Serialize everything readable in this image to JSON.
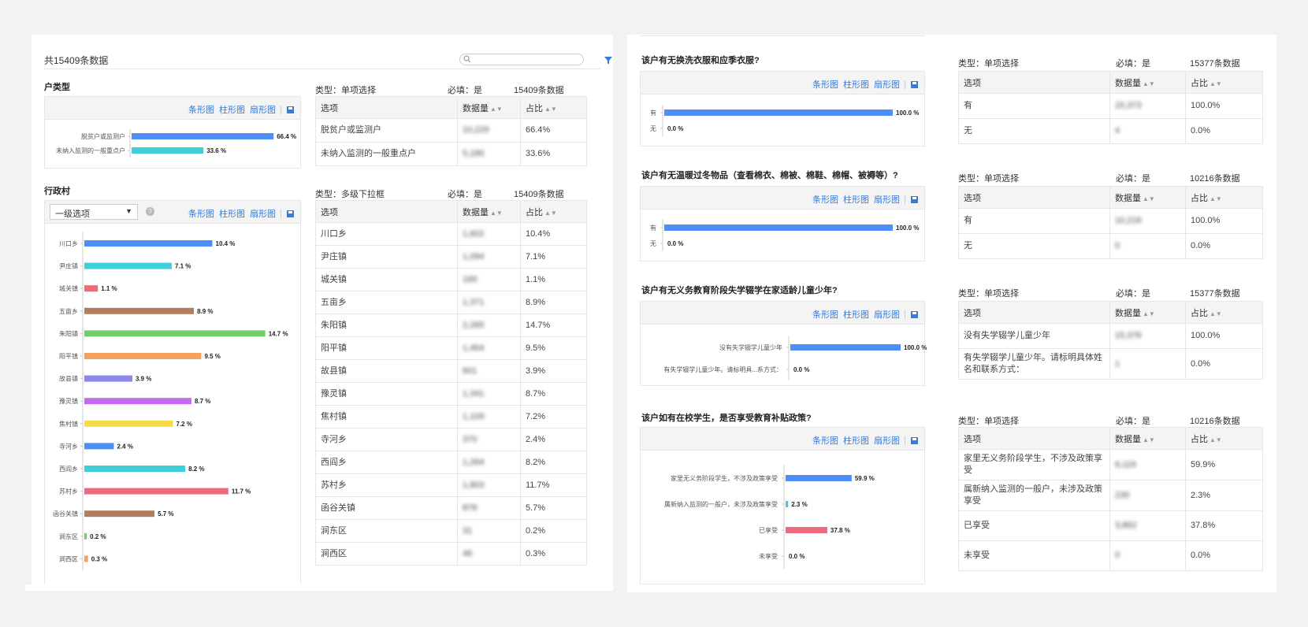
{
  "header": {
    "count_text": "共15409条数据",
    "search_placeholder": ""
  },
  "toolbar_links": {
    "bar_h": "条形图",
    "bar_v": "柱形图",
    "pie": "扇形图"
  },
  "colors": {
    "link": "#3a7bd5",
    "palette": [
      "#4e8ef7",
      "#3ecfd8",
      "#ef6a7a",
      "#b07e5c",
      "#6fd06a",
      "#f7a05c",
      "#8a88e8",
      "#c46af0",
      "#f7dc4a"
    ]
  },
  "col_headers": {
    "option": "选项",
    "count": "数据量",
    "ratio": "占比"
  },
  "left": {
    "sections": [
      {
        "title": "户类型",
        "meta": {
          "type": "类型：单项选择",
          "required": "必填：是",
          "count": "15409条数据"
        },
        "rows": [
          {
            "option": "脱贫户或监测户",
            "count": "10,229",
            "ratio": "66.4%"
          },
          {
            "option": "未纳入监测的一般重点户",
            "count": "5,180",
            "ratio": "33.6%"
          }
        ]
      },
      {
        "title": "行政村",
        "select_value": "一级选项",
        "meta": {
          "type": "类型：多级下拉框",
          "required": "必填：是",
          "count": "15409条数据"
        },
        "rows": [
          {
            "option": "川口乡",
            "count": "1,602",
            "ratio": "10.4%"
          },
          {
            "option": "尹庄镇",
            "count": "1,094",
            "ratio": "7.1%"
          },
          {
            "option": "城关镇",
            "count": "169",
            "ratio": "1.1%"
          },
          {
            "option": "五亩乡",
            "count": "1,371",
            "ratio": "8.9%"
          },
          {
            "option": "朱阳镇",
            "count": "2,265",
            "ratio": "14.7%"
          },
          {
            "option": "阳平镇",
            "count": "1,464",
            "ratio": "9.5%"
          },
          {
            "option": "故县镇",
            "count": "601",
            "ratio": "3.9%"
          },
          {
            "option": "豫灵镇",
            "count": "1,341",
            "ratio": "8.7%"
          },
          {
            "option": "焦村镇",
            "count": "1,109",
            "ratio": "7.2%"
          },
          {
            "option": "寺河乡",
            "count": "370",
            "ratio": "2.4%"
          },
          {
            "option": "西阎乡",
            "count": "1,264",
            "ratio": "8.2%"
          },
          {
            "option": "苏村乡",
            "count": "1,803",
            "ratio": "11.7%"
          },
          {
            "option": "函谷关镇",
            "count": "878",
            "ratio": "5.7%"
          },
          {
            "option": "涧东区",
            "count": "31",
            "ratio": "0.2%"
          },
          {
            "option": "涧西区",
            "count": "46",
            "ratio": "0.3%"
          }
        ]
      }
    ]
  },
  "right": {
    "sections": [
      {
        "title": "该户有无换洗衣服和应季衣服?",
        "meta": {
          "type": "类型：单项选择",
          "required": "必填：是",
          "count": "15377条数据"
        },
        "rows": [
          {
            "option": "有",
            "count": "15,373",
            "ratio": "100.0%"
          },
          {
            "option": "无",
            "count": "4",
            "ratio": "0.0%"
          }
        ]
      },
      {
        "title": "该户有无温暖过冬物品（查看棉衣、棉被、棉鞋、棉帽、被褥等）?",
        "meta": {
          "type": "类型：单项选择",
          "required": "必填：是",
          "count": "10216条数据"
        },
        "rows": [
          {
            "option": "有",
            "count": "10,216",
            "ratio": "100.0%"
          },
          {
            "option": "无",
            "count": "0",
            "ratio": "0.0%"
          }
        ]
      },
      {
        "title": "该户有无义务教育阶段失学辍学在家适龄儿童少年?",
        "meta": {
          "type": "类型：单项选择",
          "required": "必填：是",
          "count": "15377条数据"
        },
        "rows": [
          {
            "option": "没有失学辍学儿童少年",
            "count": "15,376",
            "ratio": "100.0%"
          },
          {
            "option": "有失学辍学儿童少年。请标明具体姓名和联系方式：",
            "count": "1",
            "ratio": "0.0%"
          }
        ],
        "chart_label_short": "有失学辍学儿童少年。请标明具...系方式："
      },
      {
        "title": "该户如有在校学生，是否享受教育补贴政策?",
        "meta": {
          "type": "类型：单项选择",
          "required": "必填：是",
          "count": "10216条数据"
        },
        "rows": [
          {
            "option": "家里无义务阶段学生，不涉及政策享受",
            "count": "6,119",
            "ratio": "59.9%"
          },
          {
            "option": "属新纳入监测的一般户，未涉及政策享受",
            "count": "235",
            "ratio": "2.3%"
          },
          {
            "option": "已享受",
            "count": "3,862",
            "ratio": "37.8%"
          },
          {
            "option": "未享受",
            "count": "0",
            "ratio": "0.0%"
          }
        ],
        "chart_labels_short": [
          "家里无义务阶段学生，不涉及政策享受",
          "属新纳入监测的一般户，未涉及政策享受",
          "已享受",
          "未享受"
        ]
      }
    ]
  },
  "chart_data": [
    {
      "type": "bar",
      "orientation": "horizontal",
      "categories": [
        "脱贫户或监测户",
        "未纳入监测的一般重点户"
      ],
      "values": [
        66.4,
        33.6
      ],
      "value_labels": [
        "66.4 %",
        "33.6 %"
      ]
    },
    {
      "type": "bar",
      "orientation": "horizontal",
      "categories": [
        "川口乡",
        "尹庄镇",
        "城关镇",
        "五亩乡",
        "朱阳镇",
        "阳平镇",
        "故县镇",
        "豫灵镇",
        "焦村镇",
        "寺河乡",
        "西阎乡",
        "苏村乡",
        "函谷关镇",
        "涧东区",
        "涧西区"
      ],
      "values": [
        10.4,
        7.1,
        1.1,
        8.9,
        14.7,
        9.5,
        3.9,
        8.7,
        7.2,
        2.4,
        8.2,
        11.7,
        5.7,
        0.2,
        0.3
      ],
      "value_labels": [
        "10.4 %",
        "7.1 %",
        "1.1 %",
        "8.9 %",
        "14.7 %",
        "9.5 %",
        "3.9 %",
        "8.7 %",
        "7.2 %",
        "2.4 %",
        "8.2 %",
        "11.7 %",
        "5.7 %",
        "0.2 %",
        "0.3 %"
      ]
    },
    {
      "type": "bar",
      "orientation": "horizontal",
      "categories": [
        "有",
        "无"
      ],
      "values": [
        100.0,
        0.0
      ],
      "value_labels": [
        "100.0 %",
        "0.0 %"
      ]
    },
    {
      "type": "bar",
      "orientation": "horizontal",
      "categories": [
        "有",
        "无"
      ],
      "values": [
        100.0,
        0.0
      ],
      "value_labels": [
        "100.0 %",
        "0.0 %"
      ]
    },
    {
      "type": "bar",
      "orientation": "horizontal",
      "categories": [
        "没有失学辍学儿童少年",
        "有失学辍学儿童少年。请标明具...系方式："
      ],
      "values": [
        100.0,
        0.0
      ],
      "value_labels": [
        "100.0 %",
        "0.0 %"
      ]
    },
    {
      "type": "bar",
      "orientation": "horizontal",
      "categories": [
        "家里无义务阶段学生，不涉及政策享受",
        "属新纳入监测的一般户，未涉及政策享受",
        "已享受",
        "未享受"
      ],
      "values": [
        59.9,
        2.3,
        37.8,
        0.0
      ],
      "value_labels": [
        "59.9 %",
        "2.3 %",
        "37.8 %",
        "0.0 %"
      ]
    }
  ]
}
